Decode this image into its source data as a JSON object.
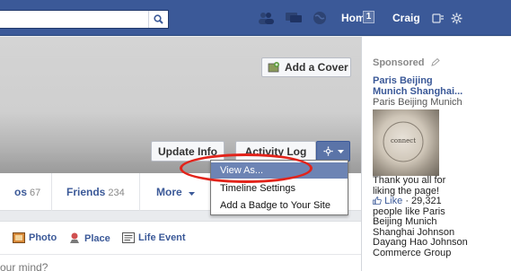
{
  "header": {
    "home_label": "Home",
    "home_badge": "1",
    "user_name": "Craig"
  },
  "cover": {
    "add_cover_label": "Add a Cover",
    "update_info_label": "Update Info",
    "activity_log_label": "Activity Log"
  },
  "tabs": [
    {
      "label": "os",
      "count": "67"
    },
    {
      "label": "Friends",
      "count": "234"
    },
    {
      "label": "More",
      "count": ""
    }
  ],
  "dropdown": {
    "items": [
      "View As...",
      "Timeline Settings",
      "Add a Badge to Your Site"
    ],
    "selected": "View As..."
  },
  "composer": {
    "photo_label": "Photo",
    "place_label": "Place",
    "life_event_label": "Life Event",
    "prompt": "our mind?"
  },
  "sidebar": {
    "sponsored_label": "Sponsored",
    "ad_title_line1": "Paris Beijing",
    "ad_title_line2": "Munich Shanghai...",
    "ad_subtitle": "Paris Beijing Munich",
    "ad_image_text": "connect",
    "ad_body_line1": "Thank you all for",
    "ad_body_line2": "liking the page!",
    "like_label": "Like",
    "like_count": "· 29,321",
    "people_line1": "people like Paris",
    "people_line2": "Beijing Munich",
    "people_line3": "Shanghai Johnson",
    "people_line4": "Dayang Hao Johnson",
    "people_line5": "Commerce Group"
  },
  "colors": {
    "brand": "#3b5998",
    "selected_item": "#6d84b4",
    "highlight_oval": "#e2231a"
  }
}
